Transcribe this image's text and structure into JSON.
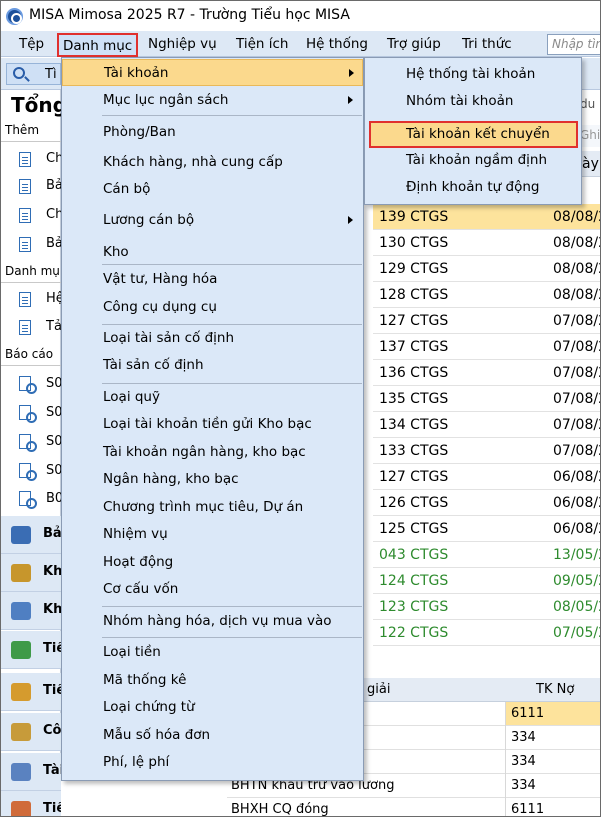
{
  "window": {
    "title": "MISA Mimosa 2025 R7 - Trường Tiểu học MISA"
  },
  "menubar": {
    "items": [
      "Tệp",
      "Danh mục",
      "Nghiệp vụ",
      "Tiện ích",
      "Hệ thống",
      "Trợ giúp",
      "Tri thức"
    ],
    "active": "Danh mục",
    "search_placeholder": "Nhập tìn"
  },
  "toolbar": {
    "search_button": "Tì"
  },
  "sidebar": {
    "title": "Tổng",
    "sections": [
      "Thêm",
      "Danh mụ",
      "Báo cáo"
    ],
    "them_items": [
      "Ch",
      "Bả",
      "Ch",
      "Bả"
    ],
    "danhmuc_items": [
      "Hệ",
      "Tả"
    ],
    "report_items": [
      "S0",
      "S0",
      "S0",
      "S0",
      "B0"
    ],
    "nav": [
      "Bả",
      "Kh",
      "Kh",
      "Tiề",
      "Tiề",
      "Côn",
      "Tài sản cố định",
      "Tiền lương"
    ]
  },
  "danh_muc_menu": {
    "items": [
      {
        "label": "Tài khoản",
        "submenu": true,
        "highlighted": true
      },
      {
        "label": "Mục lục ngân sách",
        "submenu": true
      },
      {
        "label": "Phòng/Ban"
      },
      {
        "label": "Khách hàng, nhà cung cấp"
      },
      {
        "label": "Cán bộ"
      },
      {
        "label": "Lương cán bộ",
        "submenu": true
      },
      {
        "label": "Kho"
      },
      {
        "label": "Vật tư, Hàng hóa"
      },
      {
        "label": "Công cụ dụng cụ"
      },
      {
        "label": "Loại tài sản cố định"
      },
      {
        "label": "Tài sản cố định"
      },
      {
        "label": "Loại quỹ"
      },
      {
        "label": "Loại tài khoản tiền gửi Kho bạc"
      },
      {
        "label": "Tài khoản ngân hàng, kho bạc"
      },
      {
        "label": "Ngân hàng, kho bạc"
      },
      {
        "label": "Chương trình mục tiêu, Dự án"
      },
      {
        "label": "Nhiệm vụ"
      },
      {
        "label": "Hoạt động"
      },
      {
        "label": "Cơ cấu vốn"
      },
      {
        "label": "Nhóm hàng hóa, dịch vụ mua vào"
      },
      {
        "label": "Loại tiền"
      },
      {
        "label": "Mã thống kê"
      },
      {
        "label": "Loại chứng từ"
      },
      {
        "label": "Mẫu số hóa đơn"
      },
      {
        "label": "Phí, lệ phí"
      }
    ]
  },
  "tai_khoan_submenu": {
    "items": [
      {
        "label": "Hệ thống tài khoản"
      },
      {
        "label": "Nhóm tài khoản"
      },
      {
        "label": "Tài khoản kết chuyển",
        "highlighted": true
      },
      {
        "label": "Tài khoản ngầm định"
      },
      {
        "label": "Định khoản tự động"
      }
    ]
  },
  "right_panel": {
    "header_fragments": [
      "du",
      "Ghi",
      "ày"
    ]
  },
  "vouchers": {
    "rows": [
      {
        "no": "139 CTGS",
        "date": "08/08/2",
        "selected": true
      },
      {
        "no": "130 CTGS",
        "date": "08/08/2"
      },
      {
        "no": "129 CTGS",
        "date": "08/08/2"
      },
      {
        "no": "128 CTGS",
        "date": "08/08/2"
      },
      {
        "no": "127 CTGS",
        "date": "07/08/2"
      },
      {
        "no": "137 CTGS",
        "date": "07/08/2"
      },
      {
        "no": "136 CTGS",
        "date": "07/08/2"
      },
      {
        "no": "135 CTGS",
        "date": "07/08/2"
      },
      {
        "no": "134 CTGS",
        "date": "07/08/2"
      },
      {
        "no": "133 CTGS",
        "date": "07/08/2"
      },
      {
        "no": "127 CTGS",
        "date": "06/08/2"
      },
      {
        "no": "126 CTGS",
        "date": "06/08/2"
      },
      {
        "no": "125 CTGS",
        "date": "06/08/2"
      },
      {
        "no": "043 CTGS",
        "date": "13/05/2",
        "green": true
      },
      {
        "no": "124 CTGS",
        "date": "09/05/2",
        "green": true
      },
      {
        "no": "123 CTGS",
        "date": "08/05/2",
        "green": true
      },
      {
        "no": "122 CTGS",
        "date": "07/05/2",
        "green": true
      }
    ]
  },
  "detail_table": {
    "headers": [
      "giải",
      "TK Nợ"
    ],
    "rows": [
      {
        "desc": "",
        "tk": "6111",
        "selected": true
      },
      {
        "desc": "ương",
        "tk": "334"
      },
      {
        "desc": "ương",
        "tk": "334"
      },
      {
        "desc": "BHTN khấu trừ vào lương",
        "tk": "334"
      },
      {
        "desc": "BHXH CQ đóng",
        "tk": "6111"
      }
    ]
  },
  "colors": {
    "menu_bg": "#dbe8f8",
    "highlight": "#fbd98d",
    "callout_red": "#e0302e",
    "selected_row": "#fde39c",
    "green_text": "#2e8b2e"
  }
}
